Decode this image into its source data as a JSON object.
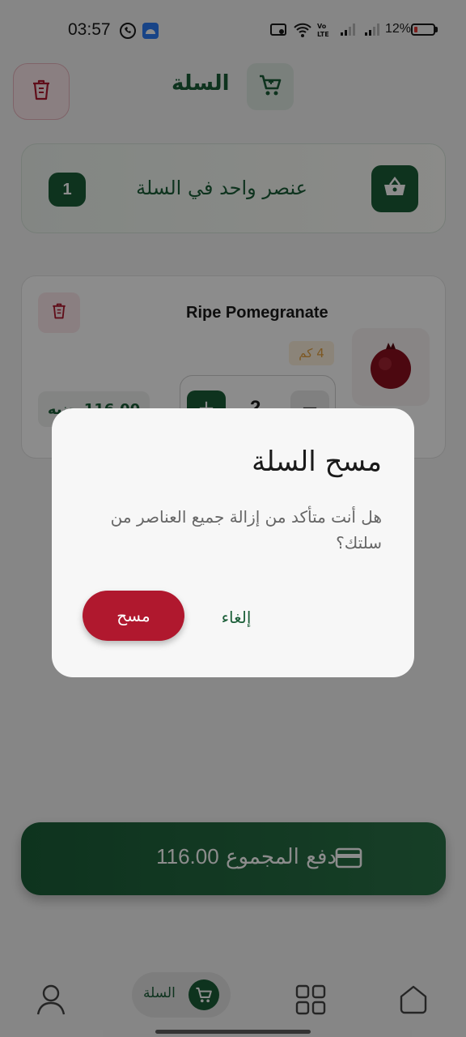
{
  "status_bar": {
    "time": "03:57",
    "battery": "12%",
    "icons": [
      "whatsapp-icon",
      "android-notification-icon",
      "screen-record-icon",
      "wifi-icon",
      "volte-icon",
      "signal-icon",
      "signal-icon",
      "battery-icon"
    ]
  },
  "header": {
    "title": "السلة",
    "trash_icon": "trash-icon",
    "cart_icon": "cart-icon"
  },
  "summary": {
    "count": "1",
    "text": "عنصر واحد في السلة",
    "icon": "basket-icon"
  },
  "item": {
    "name": "Ripe Pomegranate",
    "weight": "4 كم",
    "quantity": "2",
    "price": "116.00 جنيه",
    "image_icon": "pomegranate-icon"
  },
  "pay": {
    "label": "دفع المجموع",
    "amount": "116.00",
    "icon": "credit-card-icon"
  },
  "bottom_nav": {
    "active_label": "السلة",
    "items": [
      "profile-icon",
      "cart-icon",
      "grid-icon",
      "home-icon"
    ]
  },
  "dialog": {
    "title": "مسح السلة",
    "message": "هل أنت متأكد من إزالة جميع العناصر من سلتك؟",
    "confirm_label": "مسح",
    "cancel_label": "إلغاء"
  },
  "colors": {
    "primary": "#1b5e38",
    "danger": "#b0182e",
    "overlay": "#000000"
  }
}
